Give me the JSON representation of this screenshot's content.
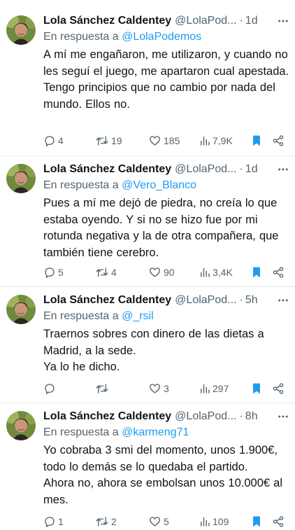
{
  "author": {
    "name": "Lola Sánchez Caldentey",
    "handle": "@LolaPod...",
    "handle_long": "@LolaPod...",
    "reply_prefix": "En respuesta a"
  },
  "colors": {
    "accent": "#1d9bf0",
    "muted": "#536471",
    "text": "#0f1419",
    "divider": "#e7e9ea"
  },
  "tweets": [
    {
      "time": "1d",
      "handle": "@LolaPod...",
      "reply_to": "@LolaPodemos",
      "lines": [
        "A mí me engañaron, me utilizaron, y cuando no les seguí el juego, me apartaron cual apestada.",
        "Tengo principios que no cambio por nada del mundo. Ellos no."
      ],
      "replies": "4",
      "retweets": "19",
      "likes": "185",
      "views": "7,9K"
    },
    {
      "time": "1d",
      "handle": "@LolaPod...",
      "reply_to": "@Vero_Blanco",
      "lines": [
        "Pues a mí me dejó de piedra, no creía lo que estaba oyendo. Y si no se hizo fue por mi rotunda negativa y la de otra compañera, que también tiene cerebro."
      ],
      "replies": "5",
      "retweets": "4",
      "likes": "90",
      "views": "3,4K"
    },
    {
      "time": "5h",
      "handle": "@LolaPod...",
      "reply_to": "@_rsil",
      "lines": [
        "Traernos sobres con dinero de las dietas a Madrid, a la sede.",
        "Ya lo he dicho."
      ],
      "replies": "",
      "retweets": "",
      "likes": "3",
      "views": "297"
    },
    {
      "time": "8h",
      "handle": "@LolaPod...",
      "reply_to": "@karmeng71",
      "lines": [
        "Yo cobraba 3 smi del momento, unos 1.900€, todo lo demás se lo quedaba el partido.",
        "Ahora no, ahora se embolsan unos 10.000€ al mes."
      ],
      "replies": "1",
      "retweets": "2",
      "likes": "5",
      "views": "109"
    }
  ]
}
